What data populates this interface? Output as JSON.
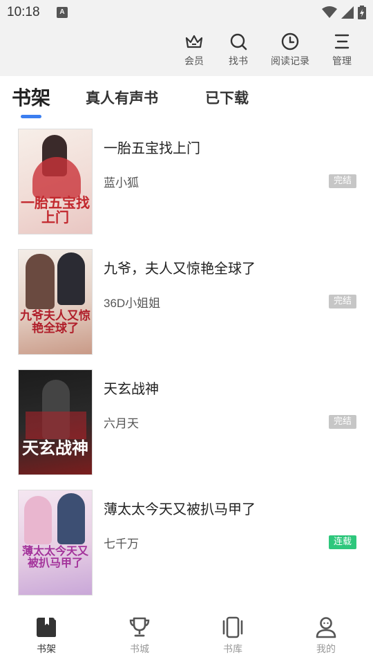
{
  "status_bar": {
    "time": "10:18",
    "notification_glyph": "A"
  },
  "toolbar": {
    "items": [
      {
        "label": "会员",
        "icon": "crown-icon"
      },
      {
        "label": "找书",
        "icon": "search-icon"
      },
      {
        "label": "阅读记录",
        "icon": "clock-icon"
      },
      {
        "label": "管理",
        "icon": "manage-icon"
      }
    ]
  },
  "tabs": {
    "items": [
      {
        "label": "书架",
        "active": true
      },
      {
        "label": "真人有声书",
        "active": false
      },
      {
        "label": "已下载",
        "active": false
      }
    ]
  },
  "books": [
    {
      "title": "一胎五宝找上门",
      "author": "蓝小狐",
      "status": "完结",
      "cover_text": "一胎五宝找上门",
      "cover_colors": [
        "#f7efe9",
        "#e9c6c2"
      ]
    },
    {
      "title": "九爷，夫人又惊艳全球了",
      "author": "36D小姐姐",
      "status": "完结",
      "cover_text": "九爷夫人又惊艳全球了",
      "cover_colors": [
        "#f3ede7",
        "#c99a87"
      ]
    },
    {
      "title": "天玄战神",
      "author": "六月天",
      "status": "完结",
      "cover_text": "天玄战神",
      "cover_colors": [
        "#2a2a2a",
        "#7a1d1d"
      ]
    },
    {
      "title": "薄太太今天又被扒马甲了",
      "author": "七千万",
      "status": "连载",
      "cover_text": "薄太太今天又被扒马甲了",
      "cover_colors": [
        "#f4e6f1",
        "#c9a7d8"
      ]
    }
  ],
  "bottom_nav": {
    "items": [
      {
        "label": "书架",
        "icon": "bookshelf-icon",
        "active": true
      },
      {
        "label": "书城",
        "icon": "trophy-icon",
        "active": false
      },
      {
        "label": "书库",
        "icon": "library-icon",
        "active": false
      },
      {
        "label": "我的",
        "icon": "profile-icon",
        "active": false
      }
    ]
  },
  "colors": {
    "accent": "#3b7ef0",
    "badge_done": "#c6c6c6",
    "badge_serial": "#2ec77c"
  }
}
